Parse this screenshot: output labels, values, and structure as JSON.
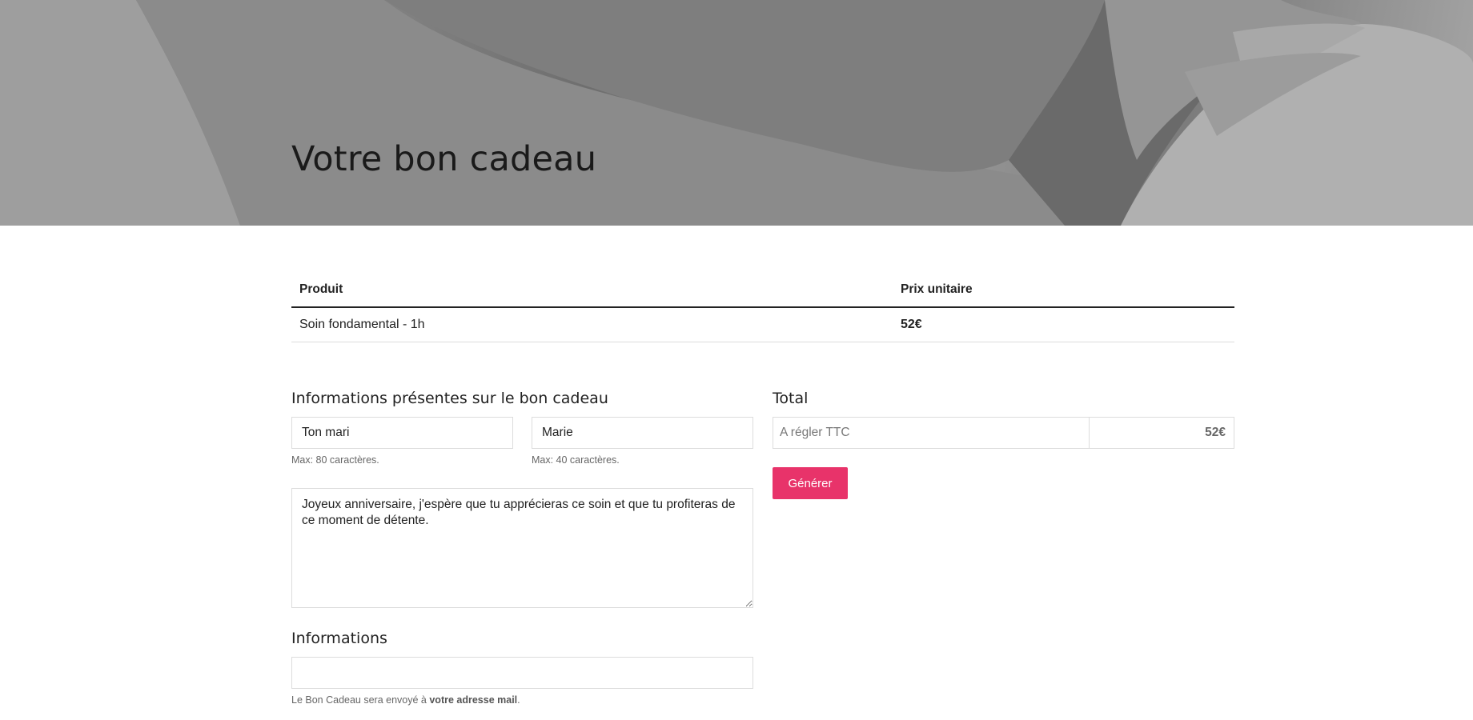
{
  "hero": {
    "title": "Votre bon cadeau"
  },
  "products_table": {
    "headers": [
      "Produit",
      "Prix unitaire"
    ],
    "rows": [
      {
        "product": "Soin fondamental - 1h",
        "price": "52€"
      }
    ]
  },
  "gift_info": {
    "title": "Informations présentes sur le bon cadeau",
    "from_value": "Ton mari",
    "from_hint": "Max: 80 caractères.",
    "to_value": "Marie",
    "to_hint": "Max: 40 caractères.",
    "message": "Joyeux anniversaire, j'espère que tu apprécieras ce soin et que tu profiteras de ce moment de détente."
  },
  "total": {
    "title": "Total",
    "label": "A régler TTC",
    "value": "52€",
    "button": "Générer"
  },
  "informations": {
    "title": "Informations",
    "email_value": "",
    "hint_prefix": "Le Bon Cadeau sera envoyé à ",
    "hint_strong": "votre adresse mail",
    "hint_suffix": "."
  },
  "colors": {
    "accent": "#e8336a",
    "hero_gray": "#8a8a8a"
  }
}
